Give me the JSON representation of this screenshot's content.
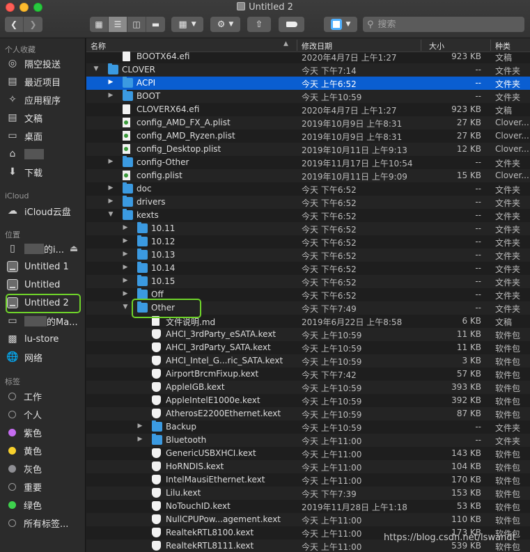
{
  "window": {
    "title": "Untitled 2"
  },
  "search": {
    "placeholder": "搜索"
  },
  "sidebar": {
    "favorites_header": "个人收藏",
    "favorites": [
      {
        "label": "隔空投送",
        "icon": "airdrop-icon"
      },
      {
        "label": "最近项目",
        "icon": "recents-icon"
      },
      {
        "label": "应用程序",
        "icon": "applications-icon"
      },
      {
        "label": "文稿",
        "icon": "documents-icon"
      },
      {
        "label": "桌面",
        "icon": "desktop-icon"
      },
      {
        "label": "",
        "icon": "home-icon"
      },
      {
        "label": "下载",
        "icon": "downloads-icon"
      }
    ],
    "icloud_header": "iCloud",
    "icloud": [
      {
        "label": "iCloud云盘",
        "icon": "icloud-icon"
      }
    ],
    "locations_header": "位置",
    "locations": [
      {
        "label": "的i...",
        "icon": "iphone-icon",
        "eject": "⏏"
      },
      {
        "label": "Untitled 1",
        "icon": "drive-icon"
      },
      {
        "label": "Untitled",
        "icon": "drive-icon"
      },
      {
        "label": "Untitled 2",
        "icon": "drive-icon"
      },
      {
        "label": "的Ma...",
        "icon": "computer-icon"
      },
      {
        "label": "lu-store",
        "icon": "server-icon"
      },
      {
        "label": "网络",
        "icon": "network-icon"
      }
    ],
    "tags_header": "标签",
    "tags": [
      {
        "label": "工作",
        "color": "#2b2b2b"
      },
      {
        "label": "个人",
        "color": "#2b2b2b"
      },
      {
        "label": "紫色",
        "color": "#c56cf0"
      },
      {
        "label": "黄色",
        "color": "#f7d02c"
      },
      {
        "label": "灰色",
        "color": "#8e8e93"
      },
      {
        "label": "重要",
        "color": "#2b2b2b"
      },
      {
        "label": "绿色",
        "color": "#3ed14d"
      },
      {
        "label": "所有标签...",
        "color": "#2b2b2b"
      }
    ]
  },
  "columns": {
    "name": "名称",
    "date": "修改日期",
    "size": "大小",
    "kind": "种类"
  },
  "rows": [
    {
      "depth": 1,
      "disc": "",
      "icon": "doc",
      "name": "BOOTX64.efi",
      "date": "2020年4月7日 上午1:27",
      "size": "923 KB",
      "kind": "文稿"
    },
    {
      "depth": 0,
      "disc": "▼",
      "icon": "folder",
      "name": "CLOVER",
      "date": "今天 下午7:14",
      "size": "--",
      "kind": "文件夹"
    },
    {
      "depth": 1,
      "disc": "▶",
      "icon": "folder",
      "name": "ACPI",
      "date": "今天 上午6:52",
      "size": "--",
      "kind": "文件夹",
      "selected": true
    },
    {
      "depth": 1,
      "disc": "▶",
      "icon": "folder",
      "name": "BOOT",
      "date": "今天 上午10:59",
      "size": "--",
      "kind": "文件夹"
    },
    {
      "depth": 1,
      "disc": "",
      "icon": "doc",
      "name": "CLOVERX64.efi",
      "date": "2020年4月7日 上午1:27",
      "size": "923 KB",
      "kind": "文稿"
    },
    {
      "depth": 1,
      "disc": "",
      "icon": "plist",
      "name": "config_AMD_FX_A.plist",
      "date": "2019年10月9日 上午8:31",
      "size": "27 KB",
      "kind": "Clover..."
    },
    {
      "depth": 1,
      "disc": "",
      "icon": "plist",
      "name": "config_AMD_Ryzen.plist",
      "date": "2019年10月9日 上午8:31",
      "size": "27 KB",
      "kind": "Clover..."
    },
    {
      "depth": 1,
      "disc": "",
      "icon": "plist",
      "name": "config_Desktop.plist",
      "date": "2019年10月11日 上午9:13",
      "size": "12 KB",
      "kind": "Clover..."
    },
    {
      "depth": 1,
      "disc": "▶",
      "icon": "folder",
      "name": "config-Other",
      "date": "2019年11月17日 上午10:54",
      "size": "--",
      "kind": "文件夹"
    },
    {
      "depth": 1,
      "disc": "",
      "icon": "plist",
      "name": "config.plist",
      "date": "2019年10月11日 上午9:09",
      "size": "15 KB",
      "kind": "Clover..."
    },
    {
      "depth": 1,
      "disc": "▶",
      "icon": "folder",
      "name": "doc",
      "date": "今天 下午6:52",
      "size": "--",
      "kind": "文件夹"
    },
    {
      "depth": 1,
      "disc": "▶",
      "icon": "folder",
      "name": "drivers",
      "date": "今天 下午6:52",
      "size": "--",
      "kind": "文件夹"
    },
    {
      "depth": 1,
      "disc": "▼",
      "icon": "folder",
      "name": "kexts",
      "date": "今天 下午6:52",
      "size": "--",
      "kind": "文件夹"
    },
    {
      "depth": 2,
      "disc": "▶",
      "icon": "folder",
      "name": "10.11",
      "date": "今天 下午6:52",
      "size": "--",
      "kind": "文件夹"
    },
    {
      "depth": 2,
      "disc": "▶",
      "icon": "folder",
      "name": "10.12",
      "date": "今天 下午6:52",
      "size": "--",
      "kind": "文件夹"
    },
    {
      "depth": 2,
      "disc": "▶",
      "icon": "folder",
      "name": "10.13",
      "date": "今天 下午6:52",
      "size": "--",
      "kind": "文件夹"
    },
    {
      "depth": 2,
      "disc": "▶",
      "icon": "folder",
      "name": "10.14",
      "date": "今天 下午6:52",
      "size": "--",
      "kind": "文件夹"
    },
    {
      "depth": 2,
      "disc": "▶",
      "icon": "folder",
      "name": "10.15",
      "date": "今天 下午6:52",
      "size": "--",
      "kind": "文件夹"
    },
    {
      "depth": 2,
      "disc": "▶",
      "icon": "folder",
      "name": "Off",
      "date": "今天 下午6:52",
      "size": "--",
      "kind": "文件夹"
    },
    {
      "depth": 2,
      "disc": "▼",
      "icon": "folder",
      "name": "Other",
      "date": "今天 下午7:49",
      "size": "--",
      "kind": "文件夹"
    },
    {
      "depth": 3,
      "disc": "",
      "icon": "doc",
      "name": "文件说明.md",
      "date": "2019年6月22日 上午8:58",
      "size": "6 KB",
      "kind": "文稿"
    },
    {
      "depth": 3,
      "disc": "",
      "icon": "kext",
      "name": "AHCI_3rdParty_eSATA.kext",
      "date": "今天 上午10:59",
      "size": "11 KB",
      "kind": "软件包"
    },
    {
      "depth": 3,
      "disc": "",
      "icon": "kext",
      "name": "AHCI_3rdParty_SATA.kext",
      "date": "今天 上午10:59",
      "size": "11 KB",
      "kind": "软件包"
    },
    {
      "depth": 3,
      "disc": "",
      "icon": "kext",
      "name": "AHCI_Intel_G...ric_SATA.kext",
      "date": "今天 上午10:59",
      "size": "3 KB",
      "kind": "软件包"
    },
    {
      "depth": 3,
      "disc": "",
      "icon": "kext",
      "name": "AirportBrcmFixup.kext",
      "date": "今天 下午7:42",
      "size": "57 KB",
      "kind": "软件包"
    },
    {
      "depth": 3,
      "disc": "",
      "icon": "kext",
      "name": "AppleIGB.kext",
      "date": "今天 上午10:59",
      "size": "393 KB",
      "kind": "软件包"
    },
    {
      "depth": 3,
      "disc": "",
      "icon": "kext",
      "name": "AppleIntelE1000e.kext",
      "date": "今天 上午10:59",
      "size": "392 KB",
      "kind": "软件包"
    },
    {
      "depth": 3,
      "disc": "",
      "icon": "kext",
      "name": "AtherosE2200Ethernet.kext",
      "date": "今天 上午10:59",
      "size": "87 KB",
      "kind": "软件包"
    },
    {
      "depth": 3,
      "disc": "▶",
      "icon": "folder",
      "name": "Backup",
      "date": "今天 上午10:59",
      "size": "--",
      "kind": "文件夹"
    },
    {
      "depth": 3,
      "disc": "▶",
      "icon": "folder",
      "name": "Bluetooth",
      "date": "今天 上午11:00",
      "size": "--",
      "kind": "文件夹"
    },
    {
      "depth": 3,
      "disc": "",
      "icon": "kext",
      "name": "GenericUSBXHCI.kext",
      "date": "今天 上午11:00",
      "size": "143 KB",
      "kind": "软件包"
    },
    {
      "depth": 3,
      "disc": "",
      "icon": "kext",
      "name": "HoRNDIS.kext",
      "date": "今天 上午11:00",
      "size": "104 KB",
      "kind": "软件包"
    },
    {
      "depth": 3,
      "disc": "",
      "icon": "kext",
      "name": "IntelMausiEthernet.kext",
      "date": "今天 上午11:00",
      "size": "170 KB",
      "kind": "软件包"
    },
    {
      "depth": 3,
      "disc": "",
      "icon": "kext",
      "name": "Lilu.kext",
      "date": "今天 下午7:39",
      "size": "153 KB",
      "kind": "软件包"
    },
    {
      "depth": 3,
      "disc": "",
      "icon": "kext",
      "name": "NoTouchID.kext",
      "date": "2019年11月28日 上午1:18",
      "size": "53 KB",
      "kind": "软件包"
    },
    {
      "depth": 3,
      "disc": "",
      "icon": "kext",
      "name": "NullCPUPow...agement.kext",
      "date": "今天 上午11:00",
      "size": "110 KB",
      "kind": "软件包"
    },
    {
      "depth": 3,
      "disc": "",
      "icon": "kext",
      "name": "RealtekRTL8100.kext",
      "date": "今天 上午11:00",
      "size": "173 KB",
      "kind": "软件包"
    },
    {
      "depth": 3,
      "disc": "",
      "icon": "kext",
      "name": "RealtekRTL8111.kext",
      "date": "今天 上午11:00",
      "size": "539 KB",
      "kind": "软件包"
    }
  ],
  "watermark": "https://blog.csdn.net/lswandt"
}
